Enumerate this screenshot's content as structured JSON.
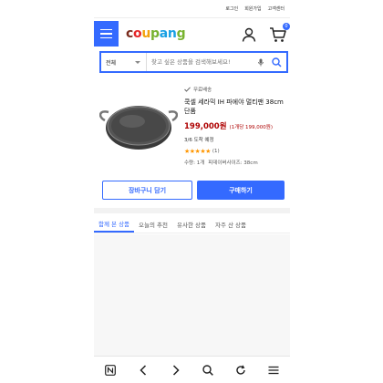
{
  "topbar": {
    "links": [
      "로그인",
      "회원가입",
      "고객센터"
    ]
  },
  "header": {
    "logo_parts": [
      {
        "text": "c",
        "color": "#7a2c1e"
      },
      {
        "text": "o",
        "color": "#e52628"
      },
      {
        "text": "u",
        "color": "#f2a20d"
      },
      {
        "text": "p",
        "color": "#78b32f"
      },
      {
        "text": "a",
        "color": "#19a0e3"
      },
      {
        "text": "n",
        "color": "#19a0e3"
      },
      {
        "text": "g",
        "color": "#78b32f"
      }
    ],
    "cart_badge": "0"
  },
  "search": {
    "category": "전체",
    "placeholder": "찾고 싶은 상품을 검색해보세요!"
  },
  "product": {
    "free_shipping": "무료배송",
    "title": "쿡셀 세라믹 IH 파에야 멀티팬 38cm 단품",
    "price": "199,000원",
    "unit_price": "(1개당 199,000원)",
    "delivery": "3/6 도착 예정",
    "stars": "★★★★★",
    "rating_value": 5,
    "review_count": "(1)",
    "quantity": "수량: 1개",
    "size": "피데이버사이즈: 38cm"
  },
  "actions": {
    "cart": "장바구니 담기",
    "buy": "구매하기"
  },
  "tabs": [
    "함께 본 상품",
    "오늘의 추천",
    "유사한 상품",
    "자주 산 상품"
  ],
  "colors": {
    "accent": "#346aff",
    "price": "#ae0000",
    "star": "#ff9600"
  },
  "bottom_nav": [
    "n-logo-icon",
    "back-icon",
    "forward-icon",
    "search-icon",
    "refresh-icon",
    "menu-icon"
  ]
}
